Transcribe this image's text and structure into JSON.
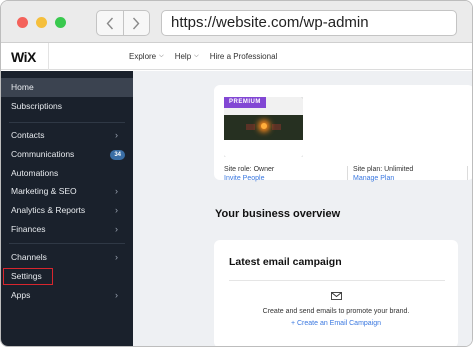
{
  "browser": {
    "url": "https://website.com/wp-admin"
  },
  "topbar": {
    "logo": "WiX",
    "nav": [
      {
        "label": "Explore",
        "has_dropdown": true
      },
      {
        "label": "Help",
        "has_dropdown": true
      },
      {
        "label": "Hire a Professional",
        "has_dropdown": false
      }
    ]
  },
  "sidebar": {
    "items": [
      {
        "label": "Home",
        "active": true
      },
      {
        "label": "Subscriptions"
      },
      {
        "label": "Contacts",
        "arrow": true
      },
      {
        "label": "Communications",
        "badge": "34"
      },
      {
        "label": "Automations"
      },
      {
        "label": "Marketing & SEO",
        "arrow": true
      },
      {
        "label": "Analytics & Reports",
        "arrow": true
      },
      {
        "label": "Finances",
        "arrow": true
      },
      {
        "label": "Channels",
        "arrow": true
      },
      {
        "label": "Settings",
        "highlighted": true
      },
      {
        "label": "Apps",
        "arrow": true
      }
    ]
  },
  "site_card": {
    "badge": "PREMIUM",
    "role_label": "Site role: Owner",
    "role_link": "Invite People",
    "plan_label": "Site plan: Unlimited",
    "plan_link": "Manage Plan"
  },
  "overview": {
    "title": "Your business overview"
  },
  "email_card": {
    "title": "Latest email campaign",
    "text": "Create and send emails to promote your brand.",
    "link": "+ Create an Email Campaign"
  },
  "colors": {
    "sidebar_bg": "#1a212c",
    "premium": "#8247d4",
    "link": "#3a78e0",
    "highlight": "#d8262e"
  }
}
